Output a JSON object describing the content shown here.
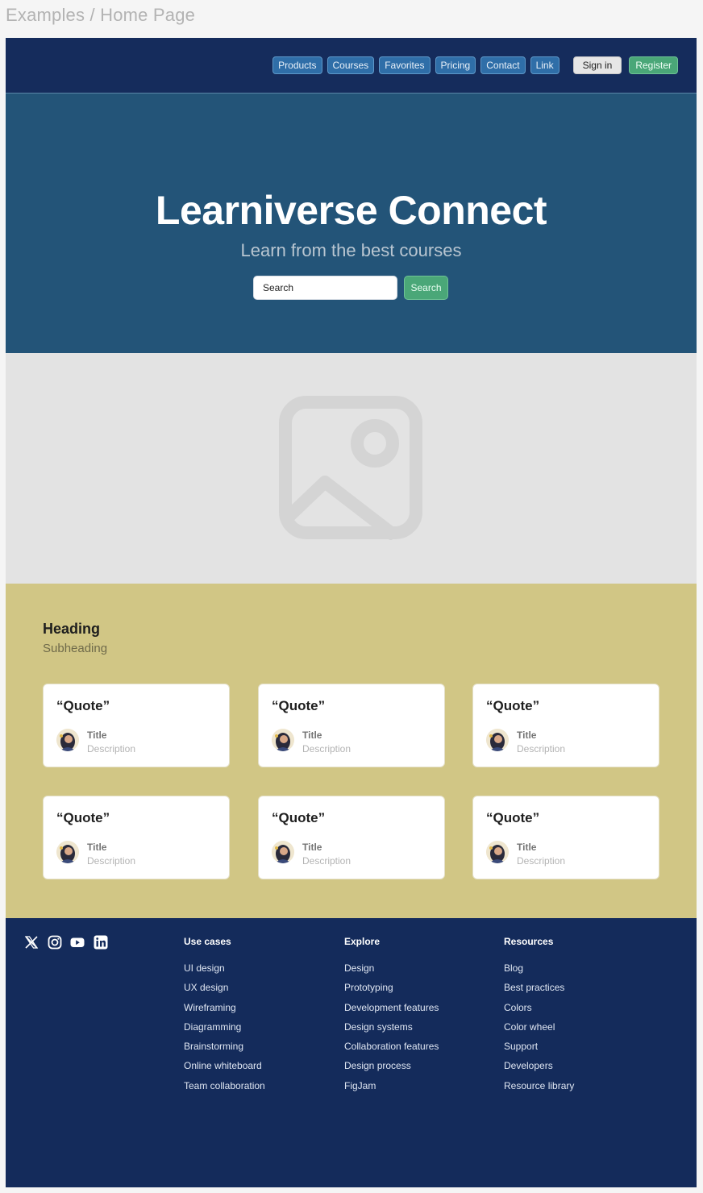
{
  "breadcrumb": "Examples / Home Page",
  "nav": {
    "items": [
      "Products",
      "Courses",
      "Favorites",
      "Pricing",
      "Contact",
      "Link"
    ],
    "sign_in": "Sign in",
    "register": "Register"
  },
  "hero": {
    "title": "Learniverse Connect",
    "subtitle": "Learn from the best courses",
    "search_value": "Search",
    "search_button": "Search"
  },
  "image_placeholder": {
    "icon": "image-placeholder-icon"
  },
  "testimonials": {
    "heading": "Heading",
    "subheading": "Subheading",
    "cards": [
      {
        "quote": "“Quote”",
        "title": "Title",
        "description": "Description"
      },
      {
        "quote": "“Quote”",
        "title": "Title",
        "description": "Description"
      },
      {
        "quote": "“Quote”",
        "title": "Title",
        "description": "Description"
      },
      {
        "quote": "“Quote”",
        "title": "Title",
        "description": "Description"
      },
      {
        "quote": "“Quote”",
        "title": "Title",
        "description": "Description"
      },
      {
        "quote": "“Quote”",
        "title": "Title",
        "description": "Description"
      }
    ]
  },
  "footer": {
    "social_icons": [
      "x-icon",
      "instagram-icon",
      "youtube-icon",
      "linkedin-icon"
    ],
    "columns": [
      {
        "heading": "Use cases",
        "links": [
          "UI design",
          "UX design",
          "Wireframing",
          "Diagramming",
          "Brainstorming",
          "Online whiteboard",
          "Team collaboration"
        ]
      },
      {
        "heading": "Explore",
        "links": [
          "Design",
          "Prototyping",
          "Development features",
          "Design systems",
          "Collaboration features",
          "Design process",
          "FigJam"
        ]
      },
      {
        "heading": "Resources",
        "links": [
          "Blog",
          "Best practices",
          "Colors",
          "Color wheel",
          "Support",
          "Developers",
          "Resource library"
        ]
      }
    ]
  },
  "colors": {
    "nav_bg": "#152c5c",
    "nav_button": "#2f6ea8",
    "hero_bg": "#235478",
    "accent_green": "#4aa778",
    "testimonials_bg": "#d1c685",
    "footer_bg": "#142b5b"
  }
}
